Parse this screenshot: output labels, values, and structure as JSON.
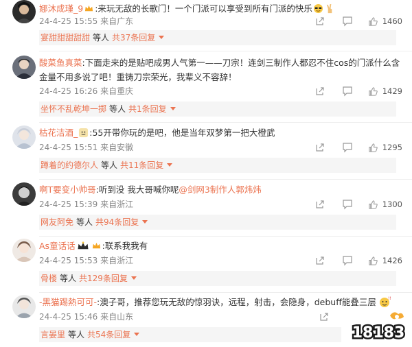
{
  "comments": [
    {
      "user": "娜沐成瑾_9",
      "text": ":来玩无敌的长歌门！一个门派可以享受到所有门派的快乐",
      "date": "24-4-25 15:55",
      "location": "来自广东",
      "likes": "1460",
      "reply_user": "宴甜甜甜甜甜",
      "reply_mid": "等人",
      "reply_total": "共37条回复"
    },
    {
      "user": "酸菜鱼真菜",
      "text": ":下面走来的是贴吧成男人气第一——刀宗！连剑三制作人都忍不住cos的门派什么含",
      "text2": "金量不用多说了吧！重铸刀宗荣光，我辈义不容辞！",
      "date": "24-4-25 16:26",
      "location": "来自重庆",
      "likes": "1429",
      "reply_user": "坐怀不乱乾坤一掷",
      "reply_mid": "等人",
      "reply_total": "共1条回复"
    },
    {
      "user": "枯花洁酒_",
      "text": ":55开带你玩的是吧，他是当年双梦第一把大橙武",
      "date": "24-4-25 15:51",
      "location": "来自安徽",
      "likes": "1295",
      "reply_user": "蹲着的约德尔人",
      "reply_mid": "等人",
      "reply_total": "共11条回复"
    },
    {
      "user": "啊T要变小帅哥",
      "text": ":听到没 我大哥喊你呢",
      "mention": "@剑网3制作人郭炜炜",
      "date": "24-4-25 15:39",
      "location": "来自浙江",
      "likes": "1300",
      "reply_user": "网友阿免",
      "reply_mid": "等人",
      "reply_total": "共94条回复"
    },
    {
      "user": "As童话话",
      "text": ":联系我我有",
      "date": "24-4-25 15:53",
      "location": "来自浙江",
      "likes": "1426",
      "reply_user": "骨楼",
      "reply_mid": "等人",
      "reply_total": "共129条回复"
    },
    {
      "user": "-黑猫踢熱可可-",
      "text": ":澳子哥，推荐您玩无敌的惊羽诀，远程，射击，会隐身，debuff能叠三层",
      "date": "24-4-25 15:46",
      "location": "来自山东",
      "likes": "",
      "reply_user": "言晏里",
      "reply_mid": "等人",
      "reply_total": "共54条回复"
    }
  ],
  "watermark": "18183",
  "colors": {
    "accent": "#eb7350",
    "meta": "#888888",
    "replybg": "#f5f5f5"
  },
  "icons": [
    "share-icon",
    "comment-icon",
    "like-icon"
  ]
}
